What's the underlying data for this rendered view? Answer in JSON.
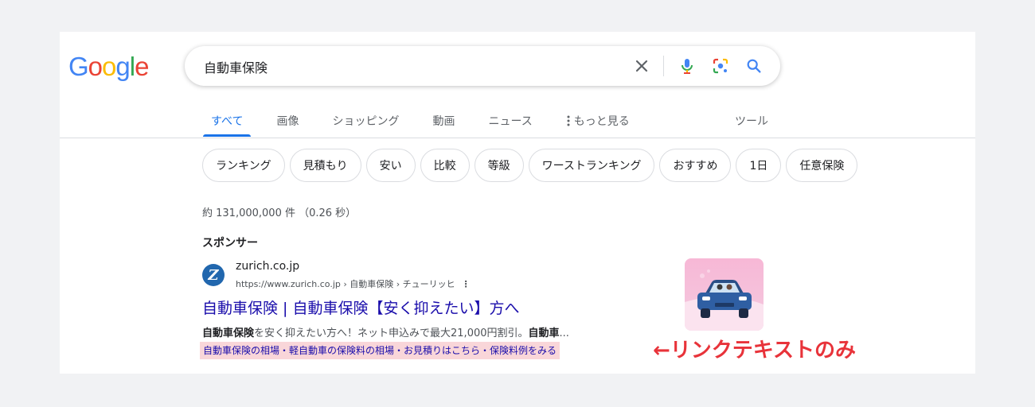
{
  "logo": {
    "letters": [
      "G",
      "o",
      "o",
      "g",
      "l",
      "e"
    ]
  },
  "search": {
    "query": "自動車保険"
  },
  "icons": {
    "clear": "close-icon",
    "mic": "mic-icon",
    "lens": "lens-icon",
    "search": "search-icon",
    "menu": "more-vert-icon"
  },
  "tabs": [
    {
      "label": "すべて",
      "active": true
    },
    {
      "label": "画像"
    },
    {
      "label": "ショッピング"
    },
    {
      "label": "動画"
    },
    {
      "label": "ニュース"
    },
    {
      "label": "もっと見る"
    }
  ],
  "tools_label": "ツール",
  "chips": [
    "ランキング",
    "見積もり",
    "安い",
    "比較",
    "等級",
    "ワーストランキング",
    "おすすめ",
    "1日",
    "任意保険"
  ],
  "stats": "約 131,000,000 件 （0.26 秒）",
  "sponsored_label": "スポンサー",
  "ad": {
    "favicon_letter": "Z",
    "domain": "zurich.co.jp",
    "url": "https://www.zurich.co.jp › 自動車保険 › チューリッヒ",
    "menu": "⋮",
    "title": "自動車保険 | 自動車保険【安く抑えたい】方へ",
    "desc_bold_1": "自動車保険",
    "desc_mid": "を安く抑えたい方へ！ネット申込みで最大21,000円割引。",
    "desc_bold_2": "自動車",
    "desc_end": "...",
    "sitelinks": "自動車保険の相場・軽自動車の保険料の相場・お見積りはこちら・保険料例をみる"
  },
  "annotation": "←リンクテキストのみ",
  "colors": {
    "link": "#1a0dab",
    "active_tab": "#1a73e8",
    "highlight": "#f9d6d9",
    "annotation": "#e8333a",
    "zurich": "#2167ae"
  }
}
